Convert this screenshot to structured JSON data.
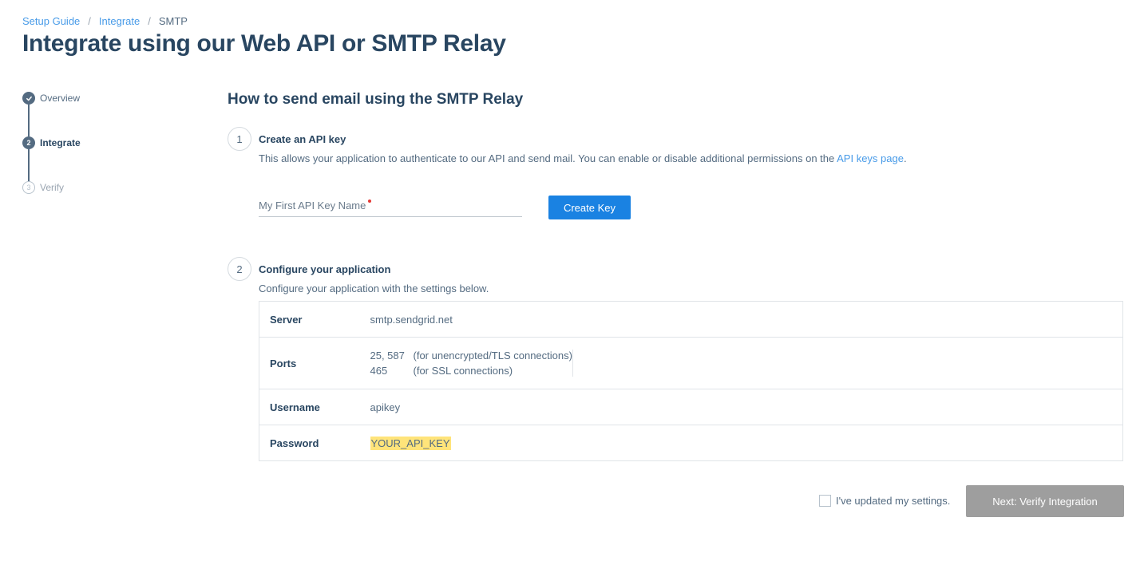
{
  "breadcrumb": {
    "items": [
      {
        "label": "Setup Guide"
      },
      {
        "label": "Integrate"
      }
    ],
    "current": "SMTP",
    "separator": "/"
  },
  "page_title": "Integrate using our Web API or SMTP Relay",
  "steps": [
    {
      "label": "Overview",
      "state": "done",
      "marker": "check-icon"
    },
    {
      "label": "Integrate",
      "state": "active",
      "marker": "2"
    },
    {
      "label": "Verify",
      "state": "pending",
      "marker": "3"
    }
  ],
  "section_title": "How to send email using the SMTP Relay",
  "step1": {
    "number": "1",
    "title": "Create an API key",
    "desc_before": "This allows your application to authenticate to our API and send mail. You can enable or disable additional permissions on the ",
    "desc_link": "API keys page",
    "desc_after": ".",
    "input_placeholder": "My First API Key Name",
    "input_value": "",
    "button": "Create Key"
  },
  "step2": {
    "number": "2",
    "title": "Configure your application",
    "desc": "Configure your application with the settings below.",
    "settings": {
      "server_label": "Server",
      "server_value": "smtp.sendgrid.net",
      "ports_label": "Ports",
      "ports": [
        {
          "port": "25, 587",
          "note": "(for unencrypted/TLS connections)"
        },
        {
          "port": "465",
          "note": "(for SSL connections)"
        }
      ],
      "username_label": "Username",
      "username_value": "apikey",
      "password_label": "Password",
      "password_value": "YOUR_API_KEY"
    }
  },
  "footer": {
    "checkbox_label": "I've updated my settings.",
    "checkbox_checked": false,
    "next_button": "Next: Verify Integration"
  },
  "colors": {
    "primary": "#1a82e2",
    "link": "#489be8",
    "heading": "#294661",
    "highlight": "#ffe47a",
    "disabled_button": "#9e9e9e"
  }
}
